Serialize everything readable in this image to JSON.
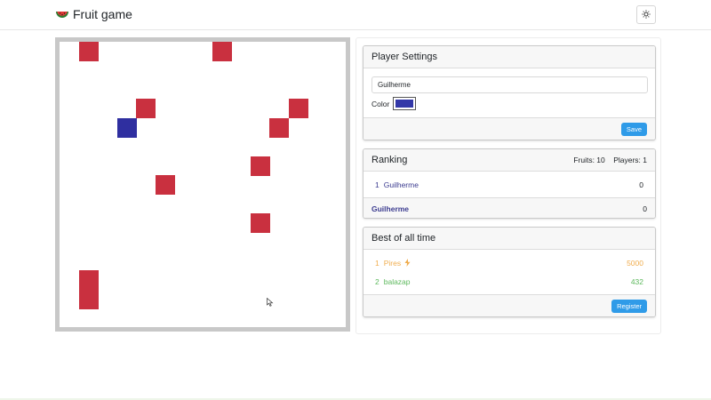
{
  "navbar": {
    "brand_title": "Fruit game",
    "brand_icon": "watermelon-icon",
    "theme_toggle_icon": "sun-icon"
  },
  "game_board": {
    "fruit_color": "#c9303f",
    "player_color": "#2f2fa0",
    "border_color": "#c8c8c8"
  },
  "player_settings": {
    "title": "Player Settings",
    "name_value": "Guilherme",
    "color_label": "Color",
    "color_value": "#3338a8",
    "save_label": "Save"
  },
  "ranking": {
    "title": "Ranking",
    "fruits_text": "Fruits: 10",
    "players_text": "Players: 1",
    "rows": [
      {
        "rank": "1",
        "name": "Guilherme",
        "score": "0"
      }
    ],
    "self_name": "Guilherme",
    "self_score": "0",
    "name_color": "#3b3b8f"
  },
  "best_of_all_time": {
    "title": "Best of all time",
    "rows": [
      {
        "rank": "1",
        "name": "Pires",
        "score": "5000",
        "color": "#f0ad4e",
        "icon": "lightning-icon"
      },
      {
        "rank": "2",
        "name": "balazap",
        "score": "432",
        "color": "#5cb85c"
      }
    ],
    "register_label": "Register"
  },
  "colors": {
    "primary_button": "#2f9be8"
  }
}
